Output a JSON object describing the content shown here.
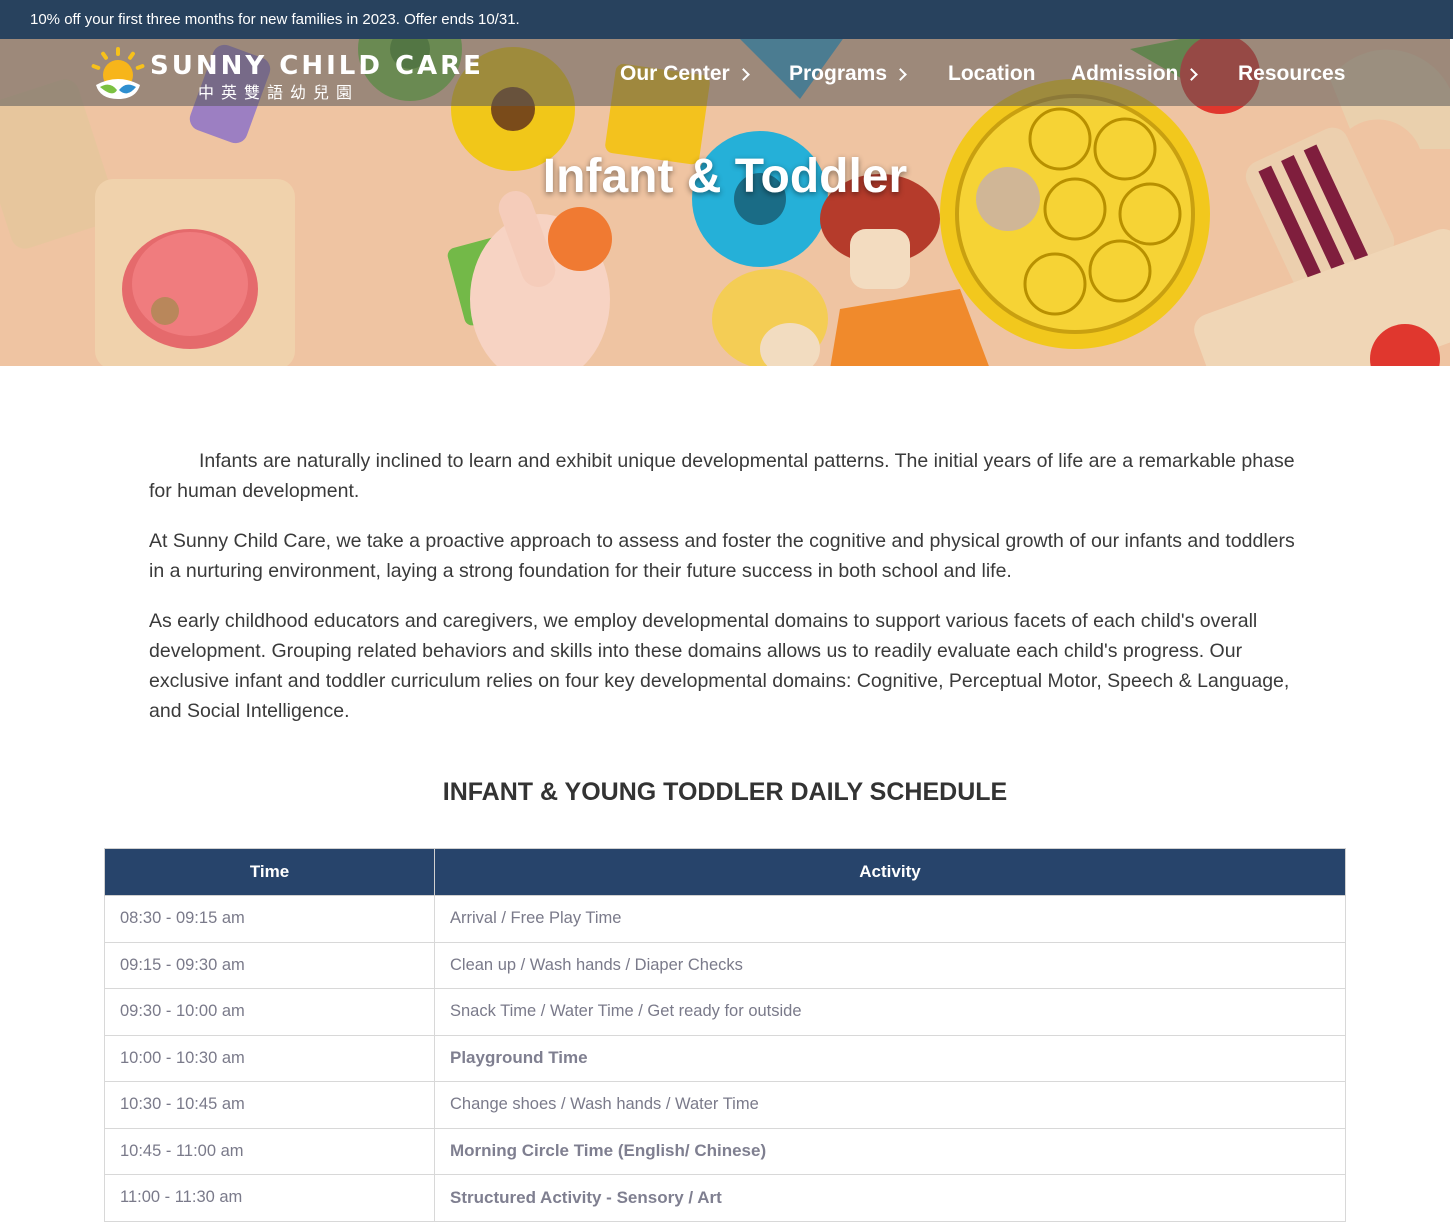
{
  "promo": {
    "text": "10% off your first three months for new families in 2023. Offer ends 10/31."
  },
  "header": {
    "logo": {
      "name": "SUNNY CHILD CARE",
      "subtitle": "中英雙語幼兒園"
    },
    "nav": [
      {
        "label": "Our Center",
        "has_submenu": true
      },
      {
        "label": "Programs",
        "has_submenu": true
      },
      {
        "label": "Location",
        "has_submenu": false
      },
      {
        "label": "Admission",
        "has_submenu": true
      },
      {
        "label": "Resources",
        "has_submenu": false
      }
    ]
  },
  "hero": {
    "title": "Infant & Toddler"
  },
  "intro": {
    "paragraphs": [
      "Infants are naturally inclined to learn and exhibit unique developmental patterns. The initial years of life are a remarkable phase for human development.",
      "At Sunny Child Care, we take a proactive approach to assess and foster the cognitive and physical growth of our infants and toddlers in a nurturing environment, laying a strong foundation for their future success in both school and life.",
      "As early childhood educators and caregivers, we employ developmental domains to support various facets of each child's overall development. Grouping related behaviors and skills into these domains allows us to readily evaluate each child's progress. Our exclusive infant and toddler curriculum relies on four key developmental domains: Cognitive, Perceptual Motor, Speech & Language, and Social Intelligence."
    ]
  },
  "schedule": {
    "title": "INFANT & YOUNG TODDLER DAILY SCHEDULE",
    "columns": [
      "Time",
      "Activity"
    ],
    "rows": [
      {
        "time": "08:30 - 09:15 am",
        "activity": "Arrival / Free Play Time",
        "bold": false
      },
      {
        "time": "09:15 - 09:30 am",
        "activity": "Clean up / Wash hands / Diaper Checks",
        "bold": false
      },
      {
        "time": "09:30 - 10:00 am",
        "activity": "Snack Time / Water Time / Get ready for outside",
        "bold": false
      },
      {
        "time": "10:00 - 10:30 am",
        "activity": "Playground Time",
        "bold": true
      },
      {
        "time": "10:30 - 10:45 am",
        "activity": "Change shoes / Wash hands / Water Time",
        "bold": false
      },
      {
        "time": "10:45 - 11:00 am",
        "activity": "Morning Circle Time (English/ Chinese)",
        "bold": true
      },
      {
        "time": "11:00 - 11:30 am",
        "activity": "Structured Activity - Sensory / Art",
        "bold": true
      }
    ]
  },
  "colors": {
    "promo_bg": "#28425e",
    "table_header_bg": "#27446b",
    "cell_text": "#7a7a8a"
  }
}
